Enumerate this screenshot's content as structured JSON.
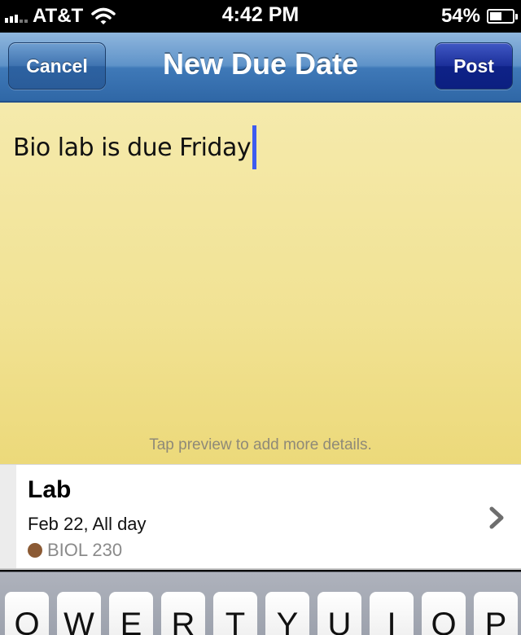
{
  "status_bar": {
    "carrier": "AT&T",
    "time": "4:42 PM",
    "battery_percent": "54%",
    "battery_level": 0.54
  },
  "nav": {
    "title": "New Due Date",
    "cancel_label": "Cancel",
    "post_label": "Post"
  },
  "note": {
    "text": "Bio lab is due Friday",
    "hint": "Tap preview to add more details."
  },
  "detail": {
    "title": "Lab",
    "date": "Feb 22, All day",
    "course": "BIOL 230",
    "course_color": "#8b5a34"
  },
  "keyboard": {
    "keys": [
      "Q",
      "W",
      "E",
      "R",
      "T",
      "Y",
      "U",
      "I",
      "O",
      "P"
    ]
  }
}
